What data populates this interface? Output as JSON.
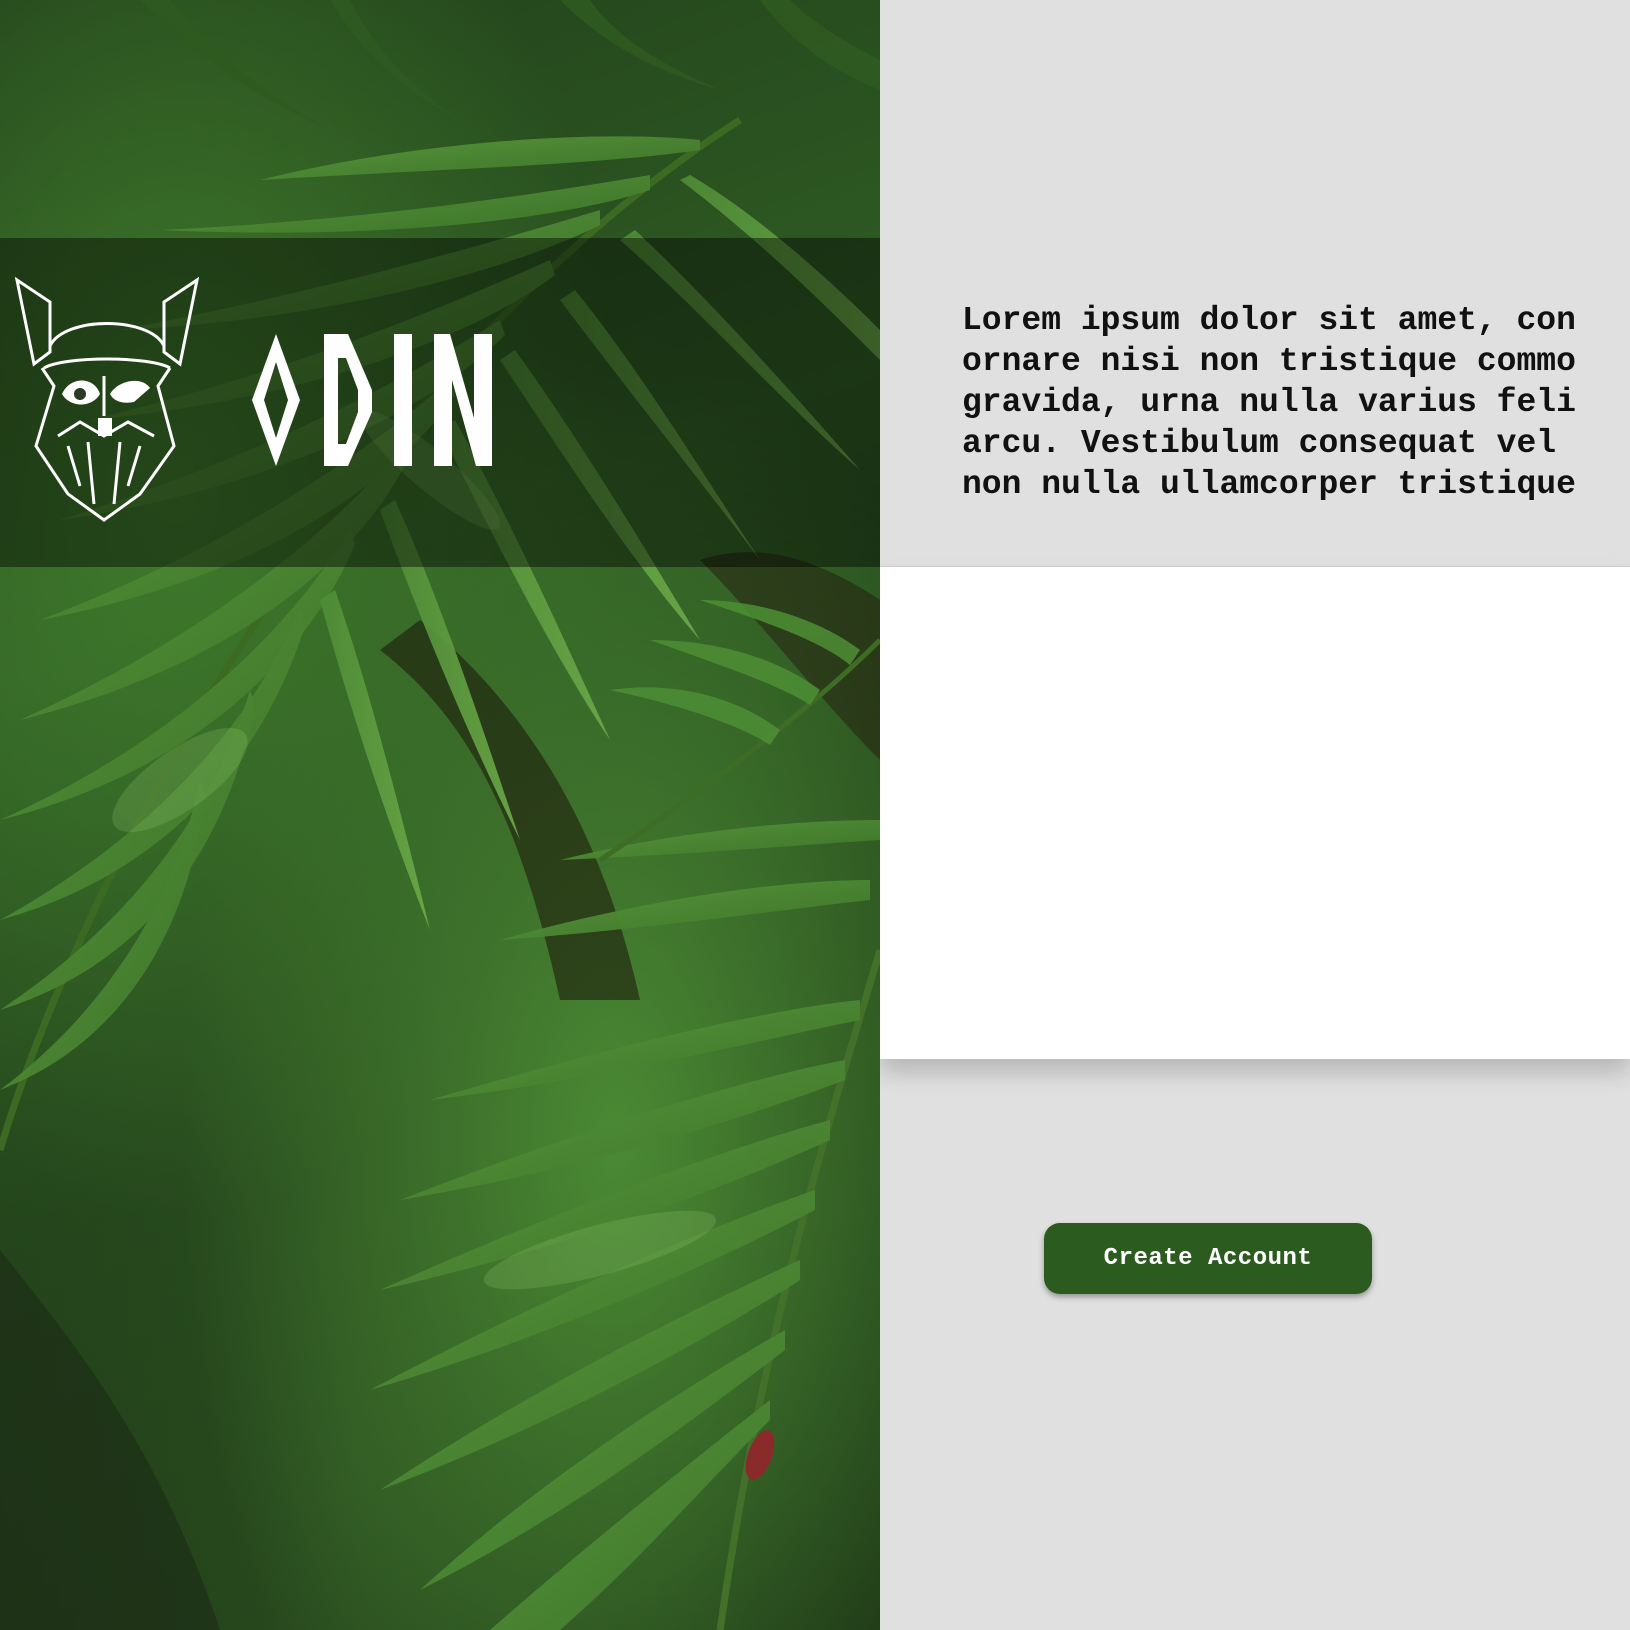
{
  "hero": {
    "logo_alt": "Odin helmet logo",
    "brand_name": "ODIN",
    "background_icon": "fern-photo"
  },
  "intro": {
    "text": "Lorem ipsum dolor sit amet, con\nornare nisi non tristique commo\ngravida, urna nulla varius feli\narcu. Vestibulum consequat vel \nnon nulla ullamcorper tristique"
  },
  "cta": {
    "label": "Create Account"
  },
  "colors": {
    "button_bg": "#2b5b1e",
    "page_bg": "#e0e0e0",
    "card_bg": "#ffffff",
    "hero_band": "rgba(0,0,0,0.42)"
  }
}
